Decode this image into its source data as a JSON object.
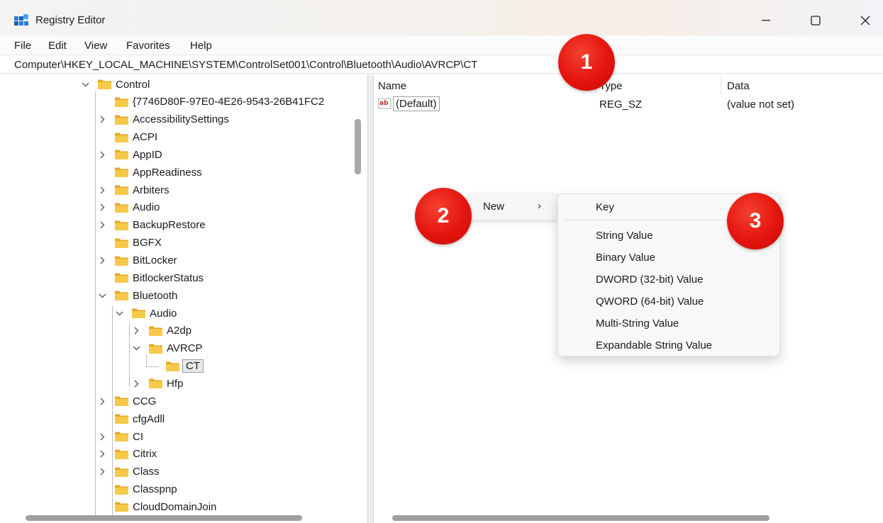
{
  "window": {
    "title": "Registry Editor",
    "controls": {
      "minimize": "—",
      "maximize": "☐",
      "close": "✕"
    }
  },
  "menubar": {
    "items": [
      "File",
      "Edit",
      "View",
      "Favorites",
      "Help"
    ]
  },
  "address": {
    "path": "Computer\\HKEY_LOCAL_MACHINE\\SYSTEM\\ControlSet001\\Control\\Bluetooth\\Audio\\AVRCP\\CT"
  },
  "tree": {
    "items": [
      {
        "label": "Control",
        "expanded": true
      },
      {
        "label": "{7746D80F-97E0-4E26-9543-26B41FC2"
      },
      {
        "label": "AccessibilitySettings"
      },
      {
        "label": "ACPI"
      },
      {
        "label": "AppID"
      },
      {
        "label": "AppReadiness"
      },
      {
        "label": "Arbiters"
      },
      {
        "label": "Audio"
      },
      {
        "label": "BackupRestore"
      },
      {
        "label": "BGFX"
      },
      {
        "label": "BitLocker"
      },
      {
        "label": "BitlockerStatus"
      },
      {
        "label": "Bluetooth",
        "expanded": true
      },
      {
        "label": "Audio",
        "expanded": true
      },
      {
        "label": "A2dp"
      },
      {
        "label": "AVRCP",
        "expanded": true
      },
      {
        "label": "CT",
        "selected": true
      },
      {
        "label": "Hfp"
      },
      {
        "label": "CCG"
      },
      {
        "label": "cfgAdll"
      },
      {
        "label": "CI"
      },
      {
        "label": "Citrix"
      },
      {
        "label": "Class"
      },
      {
        "label": "Classpnp"
      },
      {
        "label": "CloudDomainJoin"
      }
    ]
  },
  "list": {
    "columns": {
      "name": "Name",
      "type": "Type",
      "data": "Data"
    },
    "rows": [
      {
        "name": "(Default)",
        "type": "REG_SZ",
        "data": "(value not set)",
        "icon": "string-value-icon"
      }
    ]
  },
  "context_menu": {
    "new_label": "New",
    "chevron": "›",
    "submenu": [
      "Key",
      "String Value",
      "Binary Value",
      "DWORD (32-bit) Value",
      "QWORD (64-bit) Value",
      "Multi-String Value",
      "Expandable String Value"
    ]
  },
  "badges": [
    "1",
    "2",
    "3"
  ],
  "colors": {
    "badge": "#e4140e",
    "folder": "#f6c343",
    "selection": "#e8e8e8"
  }
}
